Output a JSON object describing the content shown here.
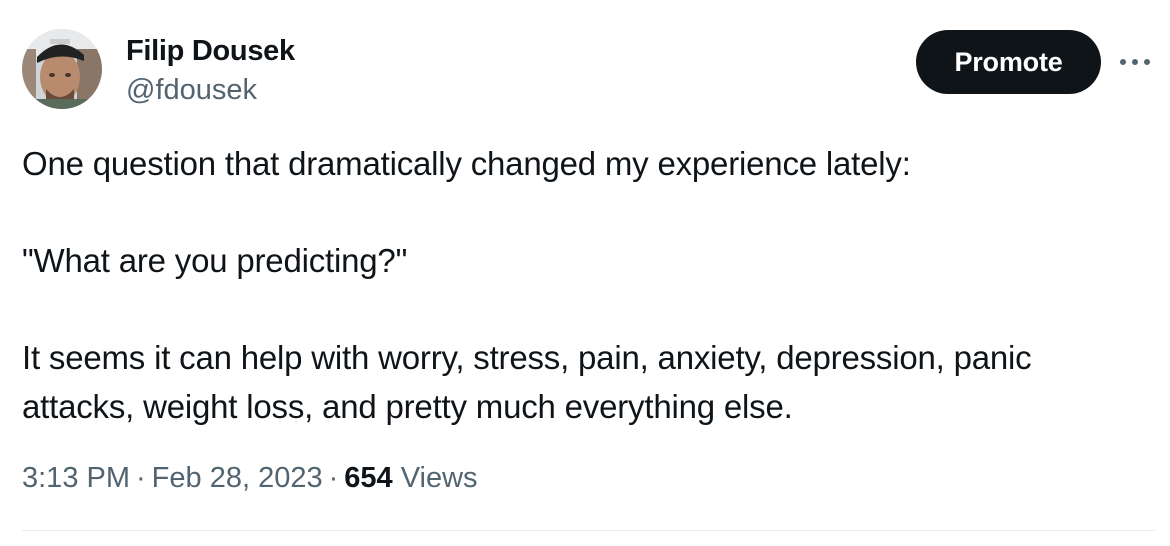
{
  "author": {
    "display_name": "Filip Dousek",
    "handle": "@fdousek"
  },
  "actions": {
    "promote_label": "Promote",
    "more_icon": "more-horizontal-icon"
  },
  "tweet": {
    "line1": "One question that dramatically changed my experience lately:",
    "line2": "\"What are you predicting?\"",
    "line3": "It seems it can help with worry, stress, pain, anxiety, depression, panic",
    "line4": "attacks, weight loss, and pretty much everything else."
  },
  "meta": {
    "time": "3:13 PM",
    "date": "Feb 28, 2023",
    "separator": "·",
    "views_count": "654",
    "views_label": "Views"
  },
  "colors": {
    "text_primary": "#0f1419",
    "text_secondary": "#536471",
    "button_bg": "#0f1419",
    "divider": "#e6ecf0"
  }
}
